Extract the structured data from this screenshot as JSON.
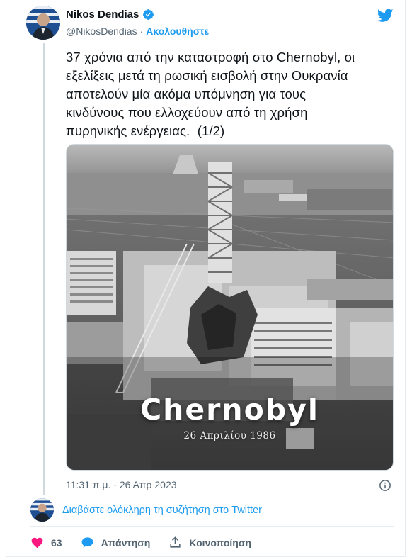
{
  "tweet": {
    "display_name": "Nikos Dendias",
    "handle": "@NikosDendias",
    "separator": "·",
    "follow_label": "Ακολουθήστε",
    "text": "37 χρόνια από την καταστροφή στο Chernobyl, οι\nεξελίξεις μετά τη ρωσική εισβολή στην Ουκρανία\nαποτελούν μία ακόμα υπόμνηση για τους\nκινδύνους που ελλοχεύουν από τη χρήση\nπυρηνικής ενέργειας.  (1/2)",
    "image": {
      "title": "Chernobyl",
      "date": "26 Απριλίου 1986"
    },
    "timestamp": "11:31 π.μ. · 26 Απρ 2023",
    "read_thread_label": "Διαβάστε ολόκληρη τη συζήτηση στο Twitter",
    "actions": {
      "like_count": "63",
      "reply_label": "Απάντηση",
      "share_label": "Κοινοποίηση"
    }
  },
  "colors": {
    "accent": "#1d9bf0",
    "like": "#f91880",
    "muted": "#536471",
    "text": "#0f1419"
  },
  "icons": [
    "verified-badge-icon",
    "twitter-bird-icon",
    "info-icon",
    "heart-icon",
    "speech-bubble-icon",
    "share-upload-icon"
  ]
}
